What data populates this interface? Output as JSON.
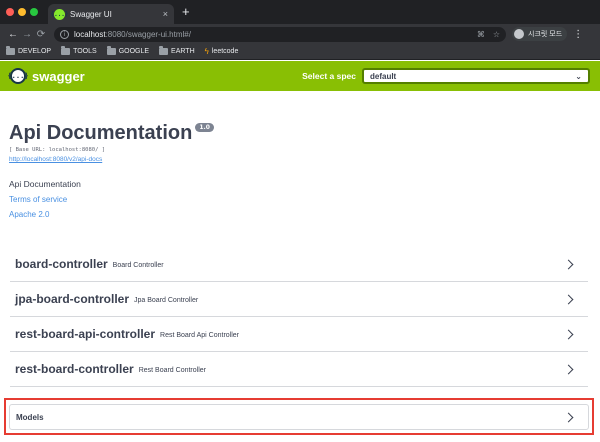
{
  "browser": {
    "tab_title": "Swagger UI",
    "tab_favicon": "{...}",
    "tab_close": "×",
    "new_tab": "+",
    "url_host": "localhost",
    "url_path": ":8080/swagger-ui.html#/",
    "profile_label": "시크릿 모드",
    "bookmarks": [
      {
        "label": "DEVELOP",
        "icon": "folder-icon"
      },
      {
        "label": "TOOLS",
        "icon": "folder-icon"
      },
      {
        "label": "GOOGLE",
        "icon": "folder-icon"
      },
      {
        "label": "EARTH",
        "icon": "folder-icon"
      },
      {
        "label": "leetcode",
        "icon": "bolt-icon"
      }
    ]
  },
  "topbar": {
    "logo_mark": "{...}",
    "logo_text": "swagger",
    "spec_label": "Select a spec",
    "spec_value": "default",
    "accent_color": "#89bf04"
  },
  "info": {
    "title": "Api Documentation",
    "version": "1.0",
    "base_url": "[ Base URL: localhost:8080/ ]",
    "docs_link": "http://localhost:8080/v2/api-docs",
    "description": "Api Documentation",
    "terms": "Terms of service",
    "license": "Apache 2.0"
  },
  "controllers": [
    {
      "name": "board-controller",
      "description": "Board Controller"
    },
    {
      "name": "jpa-board-controller",
      "description": "Jpa Board Controller"
    },
    {
      "name": "rest-board-api-controller",
      "description": "Rest Board Api Controller"
    },
    {
      "name": "rest-board-controller",
      "description": "Rest Board Controller"
    }
  ],
  "models": {
    "label": "Models",
    "highlight_color": "#e63c32"
  }
}
